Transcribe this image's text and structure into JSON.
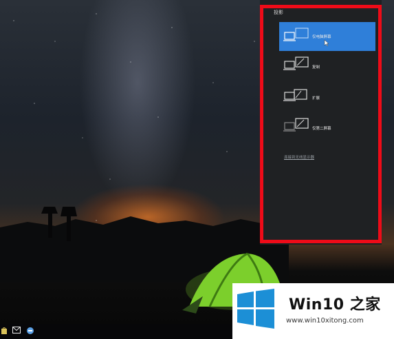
{
  "panel": {
    "title": "投影",
    "options": [
      {
        "label": "仅电脑屏幕",
        "selected": true,
        "icon": "pc-screen-only-icon"
      },
      {
        "label": "复制",
        "selected": false,
        "icon": "duplicate-icon"
      },
      {
        "label": "扩展",
        "selected": false,
        "icon": "extend-icon"
      },
      {
        "label": "仅第二屏幕",
        "selected": false,
        "icon": "second-screen-only-icon"
      }
    ],
    "connect_link": "连接到无线显示器"
  },
  "watermark": {
    "brand_prefix": "Win10",
    "brand_suffix": "之家",
    "url": "www.win10xitong.com"
  },
  "taskbar": {
    "icons": [
      "store-icon",
      "mail-icon",
      "edge-icon"
    ]
  },
  "colors": {
    "selected": "#2f7fd9",
    "highlight_border": "#ee0b18",
    "panel_bg": "#1f2123",
    "logo_blue": "#1c8fd6"
  }
}
